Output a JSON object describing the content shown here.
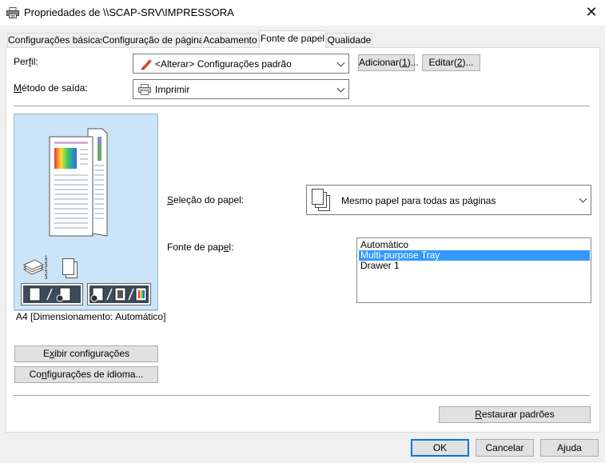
{
  "window": {
    "title": "Propriedades de \\\\SCAP-SRV\\IMPRESSORA",
    "close_glyph": "✕"
  },
  "tabs": [
    {
      "label": "Configurações básicas"
    },
    {
      "label": "Configuração de página"
    },
    {
      "label": "Acabamento"
    },
    {
      "label": "Fonte de papel",
      "active": true
    },
    {
      "label": "Qualidade"
    }
  ],
  "profile": {
    "label_pre": "Per",
    "label_u": "f",
    "label_post": "il:",
    "value": "<Alterar> Configurações padrão",
    "add_pre": "Adicionar(",
    "add_u": "1",
    "add_post": ")...",
    "edit_pre": "Editar(",
    "edit_u": "2",
    "edit_post": ")..."
  },
  "output": {
    "label_u": "M",
    "label_post": "étodo de saída:",
    "value": "Imprimir"
  },
  "paper_selection": {
    "label_u": "S",
    "label_post": "eleção do papel:",
    "value": "Mesmo papel para todas as páginas"
  },
  "paper_source": {
    "label_pre": "Fonte de pap",
    "label_u": "e",
    "label_post": "l:",
    "options": [
      "Automático",
      "Multi-purpose Tray",
      "Drawer 1"
    ],
    "selected_index": 1
  },
  "preview": {
    "status": "A4 [Dimensionamento: Automático]",
    "collate_digits": "1 2 3 1 2 3"
  },
  "left_buttons": {
    "show_pre": "E",
    "show_u": "x",
    "show_post": "ibir configurações",
    "lang_pre": "Co",
    "lang_u": "n",
    "lang_post": "figurações de idioma..."
  },
  "restore": {
    "label_u": "R",
    "label_post": "estaurar padrões"
  },
  "footer": {
    "ok": "OK",
    "cancel": "Cancelar",
    "help": "Ajuda"
  },
  "colors": {
    "selection": "#3399ff",
    "preview_bg": "#cce4f7",
    "default_button_border": "#0078d7"
  }
}
